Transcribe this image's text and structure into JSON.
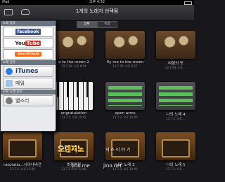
{
  "statusbar": {
    "device": "iPad",
    "time": "오후 4:32"
  },
  "navbar": {
    "title": "1개의 노래가 선택됨"
  },
  "segments": [
    "날짜",
    "이름"
  ],
  "songs": [
    {
      "name": "",
      "date": "",
      "thumb": "drums"
    },
    {
      "name": "e to the moon 2",
      "date": "13.7.29. 오후 8:54",
      "thumb": "drums"
    },
    {
      "name": "fly me to the moon",
      "date": "13.7.29. 오후 8:27",
      "thumb": "drums"
    },
    {
      "name": "여행의 맛",
      "date": "13.7.29. 오후 ...",
      "thumb": "drums"
    },
    {
      "name": "",
      "date": "",
      "thumb": "keys"
    },
    {
      "name": "ongratulation",
      "date": "13.7.2. 오후 12:45",
      "thumb": "keys"
    },
    {
      "name": "open arms",
      "date": "13.7.2. 오후 12:00",
      "thumb": "tracks"
    },
    {
      "name": "나의 노래 4",
      "date": "13.7.2. 오후 ...",
      "thumb": "tracks"
    },
    {
      "name": "ratulatio...시아나버전",
      "date": "13.7.2. 오후 11:40",
      "thumb": "amp"
    },
    {
      "name": "빗꽃연정",
      "date": "13.7.2. 오후 11:06",
      "thumb": "amp"
    },
    {
      "name": "나의 노래 2",
      "date": "13.7.2. 오후 10:45",
      "thumb": "amp"
    },
    {
      "name": "나의 노래 1",
      "date": "13.7.2. 오후 ...",
      "thumb": "amp"
    }
  ],
  "share_popup": {
    "headers": [
      "노래 공유",
      "노래 공유",
      "으로 노래 공유"
    ],
    "facebook": "facebook",
    "youtube_a": "You",
    "youtube_b": "Tube",
    "soundcloud": "SoundCloud",
    "itunes": "iTunes",
    "mail": "메일",
    "ringtone": "벨소리"
  },
  "watermark": {
    "title": "오렌지노",
    "tag": "의 소 이 야 기",
    "site1": "jino.me",
    "site2": "jino.net"
  }
}
